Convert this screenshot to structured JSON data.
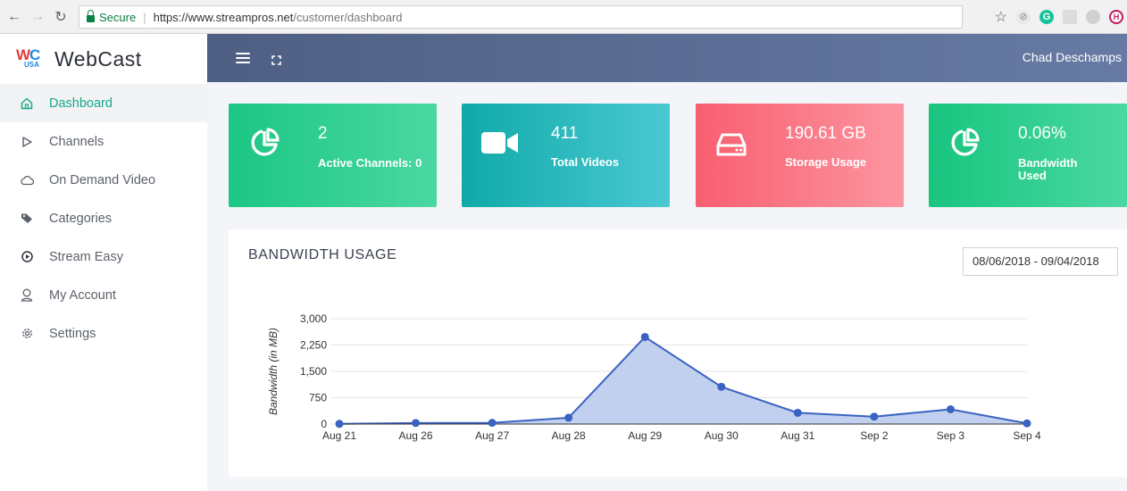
{
  "browser": {
    "secure_label": "Secure",
    "url_host": "https://www.streampros.net",
    "url_path": "/customer/dashboard"
  },
  "brand": {
    "logo_text_wc": "WC",
    "logo_text_usa": "USA",
    "name": "WebCast"
  },
  "sidebar": {
    "items": [
      {
        "label": "Dashboard",
        "icon": "home-icon",
        "active": true
      },
      {
        "label": "Channels",
        "icon": "play-outline-icon"
      },
      {
        "label": "On Demand Video",
        "icon": "cloud-icon"
      },
      {
        "label": "Categories",
        "icon": "tags-icon"
      },
      {
        "label": "Stream Easy",
        "icon": "play-circle-icon"
      },
      {
        "label": "My Account",
        "icon": "user-icon"
      },
      {
        "label": "Settings",
        "icon": "gear-icon"
      }
    ]
  },
  "topbar": {
    "user_name": "Chad Deschamps"
  },
  "cards": [
    {
      "value": "2",
      "label": "Active Channels: 0",
      "icon": "pie-chart-icon",
      "color_from": "#1cc683",
      "color_to": "#4ad8a2"
    },
    {
      "value": "411",
      "label": "Total Videos",
      "icon": "video-camera-icon",
      "color_from": "#10a9a8",
      "color_to": "#4ac9d2"
    },
    {
      "value": "190.61 GB",
      "label": "Storage Usage",
      "icon": "hard-drive-icon",
      "color_from": "#f85f70",
      "color_to": "#fc95a0"
    },
    {
      "value": "0.06%",
      "label": "Bandwidth Used",
      "icon": "pie-chart-icon",
      "color_from": "#18c57f",
      "color_to": "#4ad8a2"
    }
  ],
  "chart_panel": {
    "title": "BANDWIDTH USAGE",
    "date_range": "08/06/2018 - 09/04/2018"
  },
  "chart_data": {
    "type": "area",
    "categories": [
      "Aug 21",
      "Aug 26",
      "Aug 27",
      "Aug 28",
      "Aug 29",
      "Aug 30",
      "Aug 31",
      "Sep 2",
      "Sep 3",
      "Sep 4"
    ],
    "values": [
      5,
      30,
      35,
      180,
      2480,
      1060,
      320,
      210,
      420,
      20
    ],
    "ylabel": "Bandwidth (in MB)",
    "ylim": [
      0,
      3000
    ],
    "yticks": [
      "3,000",
      "2,250",
      "1,500",
      "750",
      "0"
    ],
    "ytick_values": [
      3000,
      2250,
      1500,
      750,
      0
    ],
    "grid": true,
    "line_color": "#3a62c2",
    "fill_color": "#b9cbec"
  }
}
